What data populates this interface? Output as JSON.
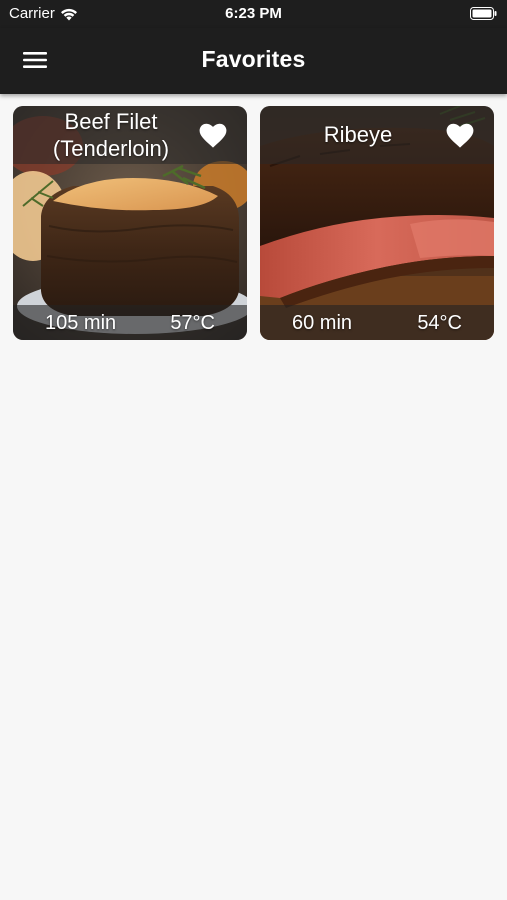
{
  "status_bar": {
    "carrier": "Carrier",
    "time": "6:23 PM",
    "wifi_icon": "wifi-icon",
    "battery_icon": "battery-icon"
  },
  "nav": {
    "title": "Favorites",
    "menu_icon": "hamburger-menu-icon"
  },
  "favorites": [
    {
      "title_line1": "Beef Filet",
      "title_line2": "(Tenderloin)",
      "time": "105 min",
      "temperature": "57°C",
      "favorited": true,
      "image": "beef-filet-photo"
    },
    {
      "title_line1": "Ribeye",
      "title_line2": "",
      "time": "60 min",
      "temperature": "54°C",
      "favorited": true,
      "image": "ribeye-photo"
    }
  ],
  "colors": {
    "bar_background": "#1e1e1e",
    "page_background": "#f7f7f7",
    "text_on_dark": "#ffffff"
  }
}
